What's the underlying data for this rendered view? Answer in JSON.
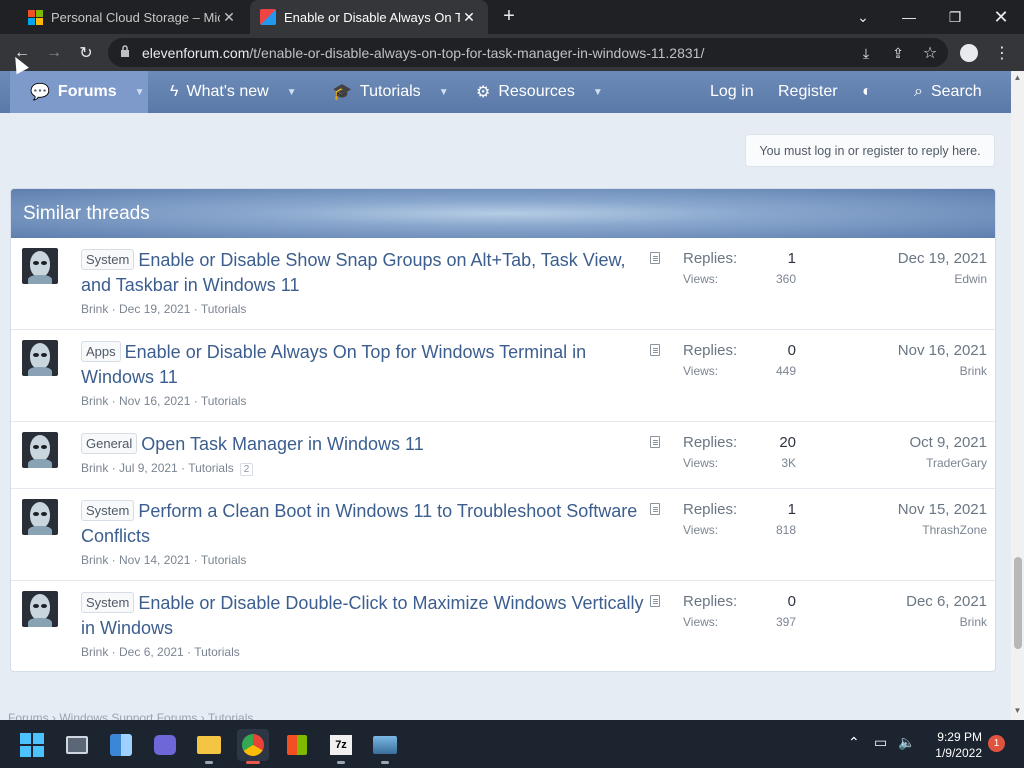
{
  "browser": {
    "tabs": [
      {
        "title": "Personal Cloud Storage – Micros",
        "active": false,
        "icon": "microsoft-logo"
      },
      {
        "title": "Enable or Disable Always On Top",
        "active": true,
        "icon": "elevenforum-favicon"
      }
    ],
    "url_host": "elevenforum.com",
    "url_path": "/t/enable-or-disable-always-on-top-for-task-manager-in-windows-11.2831/"
  },
  "nav": {
    "items": [
      {
        "label": "Forums",
        "icon": "chat-icon"
      },
      {
        "label": "What's new",
        "icon": "bolt-icon"
      },
      {
        "label": "Tutorials",
        "icon": "graduation-cap-icon"
      },
      {
        "label": "Resources",
        "icon": "gear-icon"
      }
    ],
    "login": "Log in",
    "register": "Register",
    "search": "Search"
  },
  "page": {
    "must_log_in": "You must log in or register to reply here.",
    "similar_title": "Similar threads",
    "below_text": "Forums  ›  Windows Support Forums  ›  Tutorials"
  },
  "threads": [
    {
      "prefix": "System",
      "title": "Enable or Disable Show Snap Groups on Alt+Tab, Task View, and Taskbar in Windows 11",
      "author": "Brink",
      "date": "Dec 19, 2021",
      "forum": "Tutorials",
      "pages": "",
      "replies_label": "Replies:",
      "replies": "1",
      "views_label": "Views:",
      "views": "360",
      "last_date": "Dec 19, 2021",
      "last_user": "Edwin"
    },
    {
      "prefix": "Apps",
      "title": "Enable or Disable Always On Top for Windows Terminal in Windows 11",
      "author": "Brink",
      "date": "Nov 16, 2021",
      "forum": "Tutorials",
      "pages": "",
      "replies_label": "Replies:",
      "replies": "0",
      "views_label": "Views:",
      "views": "449",
      "last_date": "Nov 16, 2021",
      "last_user": "Brink"
    },
    {
      "prefix": "General",
      "title": "Open Task Manager in Windows 11",
      "author": "Brink",
      "date": "Jul 9, 2021",
      "forum": "Tutorials",
      "pages": "2",
      "replies_label": "Replies:",
      "replies": "20",
      "views_label": "Views:",
      "views": "3K",
      "last_date": "Oct 9, 2021",
      "last_user": "TraderGary"
    },
    {
      "prefix": "System",
      "title": "Perform a Clean Boot in Windows 11 to Troubleshoot Software Conflicts",
      "author": "Brink",
      "date": "Nov 14, 2021",
      "forum": "Tutorials",
      "pages": "",
      "replies_label": "Replies:",
      "replies": "1",
      "views_label": "Views:",
      "views": "818",
      "last_date": "Nov 15, 2021",
      "last_user": "ThrashZone"
    },
    {
      "prefix": "System",
      "title": "Enable or Disable Double-Click to Maximize Windows Vertically in Windows",
      "author": "Brink",
      "date": "Dec 6, 2021",
      "forum": "Tutorials",
      "pages": "",
      "replies_label": "Replies:",
      "replies": "0",
      "views_label": "Views:",
      "views": "397",
      "last_date": "Dec 6, 2021",
      "last_user": "Brink"
    }
  ],
  "taskbar": {
    "time": "9:29 PM",
    "date": "1/9/2022",
    "notifications": "1",
    "apps": [
      "windows-start-icon",
      "task-view-icon",
      "widgets-icon",
      "teams-chat-icon",
      "file-explorer-icon",
      "chrome-icon",
      "store-icon",
      "7zip-icon",
      "photos-icon"
    ]
  },
  "colors": {
    "nav_bg": "#5f7eac",
    "nav_active": "#7d9aca",
    "link": "#3c5e8f",
    "taskbar": "#1c2430"
  }
}
